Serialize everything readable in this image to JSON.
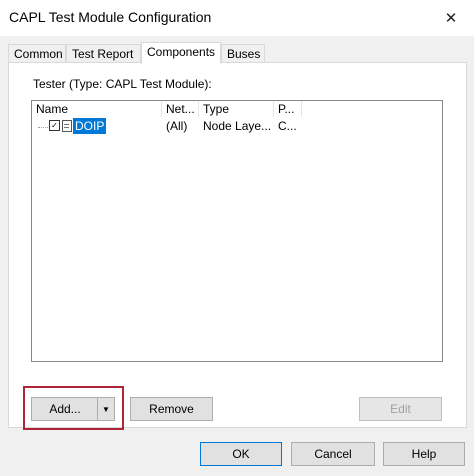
{
  "window": {
    "title": "CAPL Test Module Configuration",
    "close_glyph": "✕"
  },
  "tabs": [
    {
      "label": "Common"
    },
    {
      "label": "Test Report"
    },
    {
      "label": "Components",
      "active": true
    },
    {
      "label": "Buses"
    }
  ],
  "components": {
    "tester_label": "Tester (Type: CAPL Test Module):",
    "columns": [
      "Name",
      "Net...",
      "Type",
      "P..."
    ],
    "rows": [
      {
        "checked": true,
        "name": "DOIP",
        "network": "(All)",
        "type": "Node Laye...",
        "p": "C..."
      }
    ],
    "add_label": "Add...",
    "add_arrow": "▼",
    "remove_label": "Remove",
    "edit_label": "Edit"
  },
  "footer": {
    "ok_label": "OK",
    "cancel_label": "Cancel",
    "help_label": "Help"
  },
  "colors": {
    "selection": "#0078d7",
    "highlight_box": "#b0243a",
    "default_button_border": "#0078d7"
  }
}
